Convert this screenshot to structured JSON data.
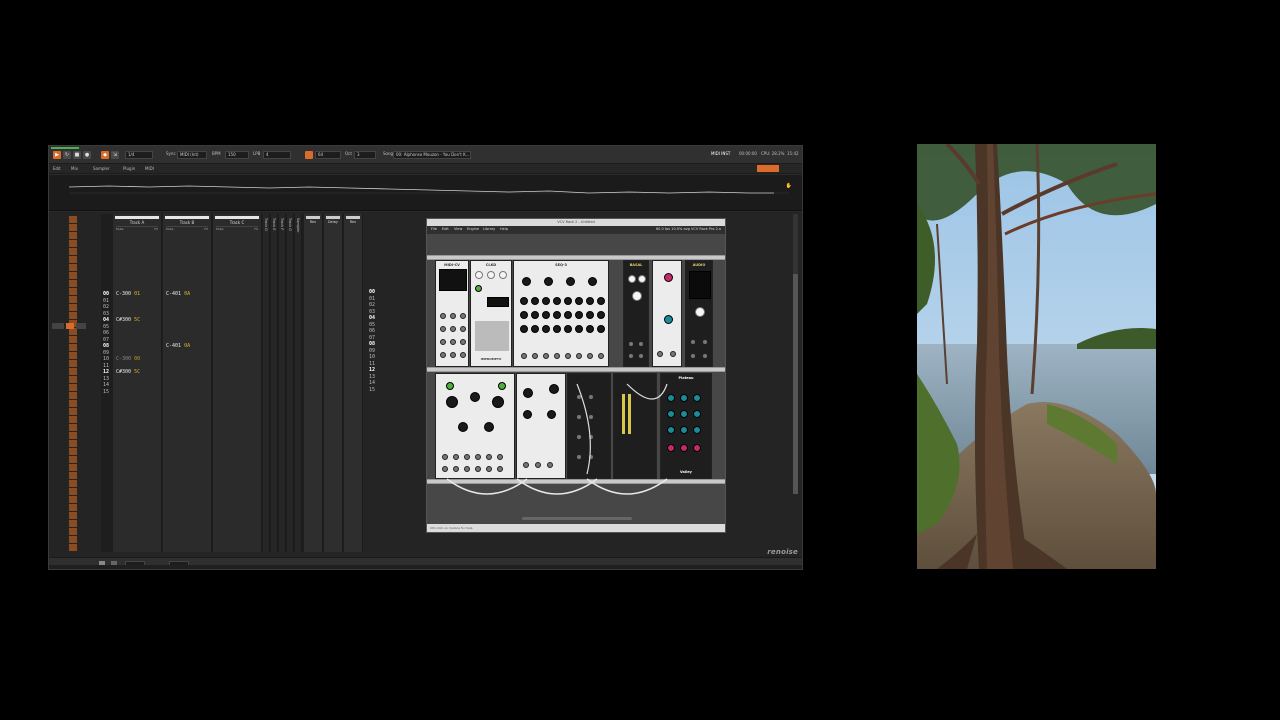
{
  "daw": {
    "toolbar": {
      "bpm_label": "BPM",
      "bpm_value": "150",
      "lpb_label": "LPB",
      "lpb_value": "4",
      "sync_label": "Sync",
      "sync_value": "MIDI (Int)",
      "oct_label": "Oct",
      "oct_value": "3",
      "step_value": "1/4",
      "song_label": "Song",
      "song_value": "00: Alphonse Mouzon - You Don't K...",
      "time_value": "00:00:00",
      "cpu_label": "CPU: 28.2%",
      "clock": "15:42",
      "midi_label": "MIDI INST"
    },
    "view_tabs": [
      "Edit",
      "Mix",
      "Sampler",
      "Plugin",
      "MIDI"
    ],
    "tracks": [
      {
        "name": "Track A",
        "sub_left": "Mute",
        "sub_right": "FX"
      },
      {
        "name": "Track B",
        "sub_left": "Mute",
        "sub_right": "FX"
      },
      {
        "name": "Track C",
        "sub_left": "Mute",
        "sub_right": "FX"
      }
    ],
    "collapsed_tracks": [
      "Track D",
      "Track E",
      "Track F",
      "Track G",
      "Sampler"
    ],
    "fx_tracks": [
      {
        "name": "Rev"
      },
      {
        "name": "Delay"
      },
      {
        "name": "Rev"
      }
    ],
    "rows": [
      "00",
      "01",
      "02",
      "03",
      "04",
      "05",
      "06",
      "07",
      "08",
      "09",
      "10",
      "11",
      "12",
      "13",
      "14",
      "15"
    ],
    "notes_track_a": [
      {
        "row": 0,
        "note": "C-3",
        "vol": "00",
        "ins": "01",
        "dim": false
      },
      {
        "row": 4,
        "note": "C#3",
        "vol": "00",
        "ins": "5C",
        "dim": false
      },
      {
        "row": 9,
        "note": "C-3",
        "vol": "00",
        "ins": "00",
        "dim": true
      },
      {
        "row": 12,
        "note": "C#3",
        "vol": "00",
        "ins": "5C",
        "dim": false
      }
    ],
    "notes_track_b": [
      {
        "row": 0,
        "note": "C-4",
        "vol": "01",
        "ins": "0A",
        "dim": false
      },
      {
        "row": 8,
        "note": "C-4",
        "vol": "01",
        "ins": "0A",
        "dim": false
      }
    ],
    "brand": "renoise"
  },
  "vcv": {
    "title": "VCV Rack 2 - Untitled",
    "menu": [
      "File",
      "Edit",
      "View",
      "Engine",
      "Library",
      "Help"
    ],
    "info": "60.0 fps  10.0% avg  VCV Rack Pro 2.x",
    "modules": {
      "midi_cv": "MIDI-CV",
      "clkd": "CLKD",
      "seq3": "SEQ-3",
      "basal": "BASAL",
      "audio": "AUDIO",
      "plateau": "Plateau",
      "valley": "Valley",
      "impromptu": "IMPROMPTU"
    },
    "status": "Ctrl-click on module for help"
  },
  "colors": {
    "accent": "#d96b2b",
    "note_text": "#e8e8e8",
    "instrument": "#e0b030",
    "daw_bg": "#2a2a2a",
    "vcv_rail": "#c9c9c9"
  }
}
